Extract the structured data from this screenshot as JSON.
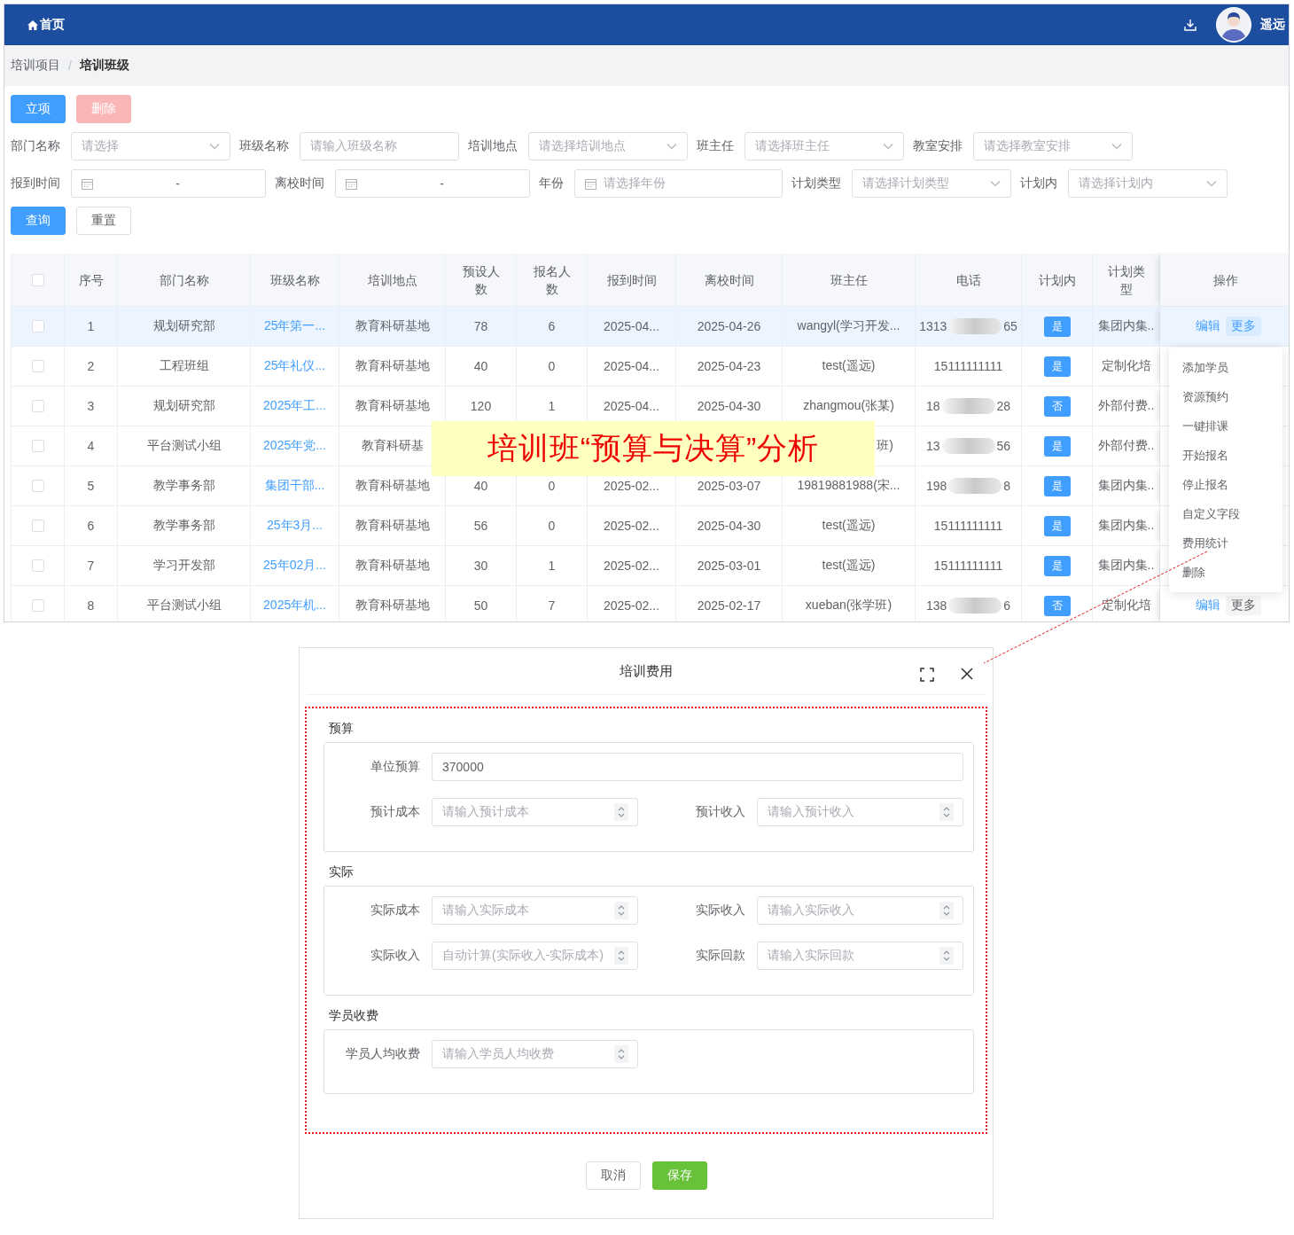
{
  "header": {
    "home": "首页",
    "user": "遥远"
  },
  "breadcrumb": [
    {
      "label": "培训项目",
      "current": false
    },
    {
      "label": "培训班级",
      "current": true
    }
  ],
  "breadcrumb_separator": "/",
  "toolbar": [
    {
      "label": "立项",
      "disabled": false
    },
    {
      "label": "删除",
      "disabled": true
    }
  ],
  "filters": [
    [
      {
        "label": "部门名称",
        "kind": "select",
        "placeholder": "请选择"
      },
      {
        "label": "班级名称",
        "kind": "input",
        "placeholder": "请输入班级名称"
      },
      {
        "label": "培训地点",
        "kind": "select",
        "placeholder": "请选择培训地点"
      },
      {
        "label": "班主任",
        "kind": "select",
        "placeholder": "请选择班主任"
      },
      {
        "label": "教室安排",
        "kind": "select",
        "placeholder": "请选择教室安排"
      }
    ],
    [
      {
        "label": "报到时间",
        "kind": "daterange",
        "separator": "-"
      },
      {
        "label": "离校时间",
        "kind": "daterange",
        "separator": "-"
      },
      {
        "label": "年份",
        "kind": "date",
        "placeholder": "请选择年份"
      },
      {
        "label": "计划类型",
        "kind": "select",
        "placeholder": "请选择计划类型"
      },
      {
        "label": "计划内",
        "kind": "select",
        "placeholder": "请选择计划内"
      }
    ]
  ],
  "search_buttons": [
    {
      "label": "查询",
      "kind": "primary"
    },
    {
      "label": "重置",
      "kind": "default"
    }
  ],
  "table": {
    "all_checked": false,
    "columns": [
      "序号",
      "部门名称",
      "班级名称",
      "培训地点",
      "预设人数",
      "报名人数",
      "报到时间",
      "离校时间",
      "班主任",
      "电话",
      "计划内",
      "计划类型",
      "操作"
    ],
    "rows": [
      {
        "checked": false,
        "highlighted": true,
        "index": "1",
        "dept": "规划研究部",
        "class_name": "25年第一...",
        "location": "教育科研基地",
        "preset": "78",
        "enrolled": "6",
        "report_date": "2025-04...",
        "leave_date": "2025-04-26",
        "teacher": "wangyl(学习开发...",
        "phone_start": "1313",
        "phone_end": "65",
        "in_plan": "是",
        "plan_type": "集团内集..",
        "actions": [
          "编辑",
          "更多"
        ]
      },
      {
        "checked": false,
        "highlighted": false,
        "index": "2",
        "dept": "工程班组",
        "class_name": "25年礼仪...",
        "location": "教育科研基地",
        "preset": "40",
        "enrolled": "0",
        "report_date": "2025-04...",
        "leave_date": "2025-04-23",
        "teacher": "test(遥远)",
        "phone": "15111111111",
        "in_plan": "是",
        "plan_type": "定制化培"
      },
      {
        "checked": false,
        "highlighted": false,
        "index": "3",
        "dept": "规划研究部",
        "class_name": "2025年工...",
        "location": "教育科研基地",
        "preset": "120",
        "enrolled": "1",
        "report_date": "2025-04...",
        "leave_date": "2025-04-30",
        "teacher": "zhangmou(张某)",
        "phone_start": "18",
        "phone_end": "28",
        "in_plan": "否",
        "plan_type": "外部付费.."
      },
      {
        "checked": false,
        "highlighted": false,
        "index": "4",
        "dept": "平台测试小组",
        "class_name": "2025年党...",
        "location": "教育科研基",
        "teacher": "班)",
        "phone_start": "13",
        "phone_end": "56",
        "in_plan": "是",
        "plan_type": "外部付费.."
      },
      {
        "checked": false,
        "highlighted": false,
        "index": "5",
        "dept": "教学事务部",
        "class_name": "集团干部...",
        "location": "教育科研基地",
        "preset": "40",
        "enrolled": "0",
        "report_date": "2025-02...",
        "leave_date": "2025-03-07",
        "teacher": "19819881988(宋...",
        "phone_start": "198",
        "phone_end": "8",
        "in_plan": "是",
        "plan_type": "集团内集.."
      },
      {
        "checked": false,
        "highlighted": false,
        "index": "6",
        "dept": "教学事务部",
        "class_name": "25年3月...",
        "location": "教育科研基地",
        "preset": "56",
        "enrolled": "0",
        "report_date": "2025-02...",
        "leave_date": "2025-04-30",
        "teacher": "test(遥远)",
        "phone": "15111111111",
        "in_plan": "是",
        "plan_type": "集团内集.."
      },
      {
        "checked": false,
        "highlighted": false,
        "index": "7",
        "dept": "学习开发部",
        "class_name": "25年02月...",
        "location": "教育科研基地",
        "preset": "30",
        "enrolled": "1",
        "report_date": "2025-02...",
        "leave_date": "2025-03-01",
        "teacher": "test(遥远)",
        "phone": "15111111111",
        "in_plan": "是",
        "plan_type": "集团内集.."
      },
      {
        "checked": false,
        "highlighted": false,
        "index": "8",
        "dept": "平台测试小组",
        "class_name": "2025年机...",
        "location": "教育科研基地",
        "preset": "50",
        "enrolled": "7",
        "report_date": "2025-02...",
        "leave_date": "2025-02-17",
        "teacher": "xueban(张学班)",
        "phone_start": "138",
        "phone_end": "6",
        "in_plan": "否",
        "plan_type": "定制化培",
        "actions": [
          "编辑",
          "更多"
        ]
      }
    ]
  },
  "annotation": {
    "text": "培训班“预算与决算”分析"
  },
  "row_menu": {
    "items": [
      "添加学员",
      "资源预约",
      "一键排课",
      "开始报名",
      "停止报名",
      "自定义字段",
      "费用统计",
      "删除"
    ]
  },
  "dialog": {
    "title": "培训费用",
    "sections": [
      {
        "title": "预算",
        "rows": [
          [
            {
              "label": "单位预算",
              "kind": "text",
              "value": "370000"
            }
          ],
          [
            {
              "label": "预计成本",
              "kind": "number",
              "placeholder": "请输入预计成本"
            },
            {
              "label": "预计收入",
              "kind": "number",
              "placeholder": "请输入预计收入"
            }
          ]
        ]
      },
      {
        "title": "实际",
        "rows": [
          [
            {
              "label": "实际成本",
              "kind": "number",
              "placeholder": "请输入实际成本"
            },
            {
              "label": "实际收入",
              "kind": "number",
              "placeholder": "请输入实际收入"
            }
          ],
          [
            {
              "label": "实际收入",
              "kind": "number",
              "placeholder": "自动计算(实际收入-实际成本)"
            },
            {
              "label": "实际回款",
              "kind": "number",
              "placeholder": "请输入实际回款"
            }
          ]
        ]
      },
      {
        "title": "学员收费",
        "rows": [
          [
            {
              "label": "学员人均收费",
              "kind": "number",
              "placeholder": "请输入学员人均收费"
            }
          ]
        ]
      }
    ],
    "buttons": [
      {
        "label": "取消",
        "kind": "default"
      },
      {
        "label": "保存",
        "kind": "success"
      }
    ]
  }
}
